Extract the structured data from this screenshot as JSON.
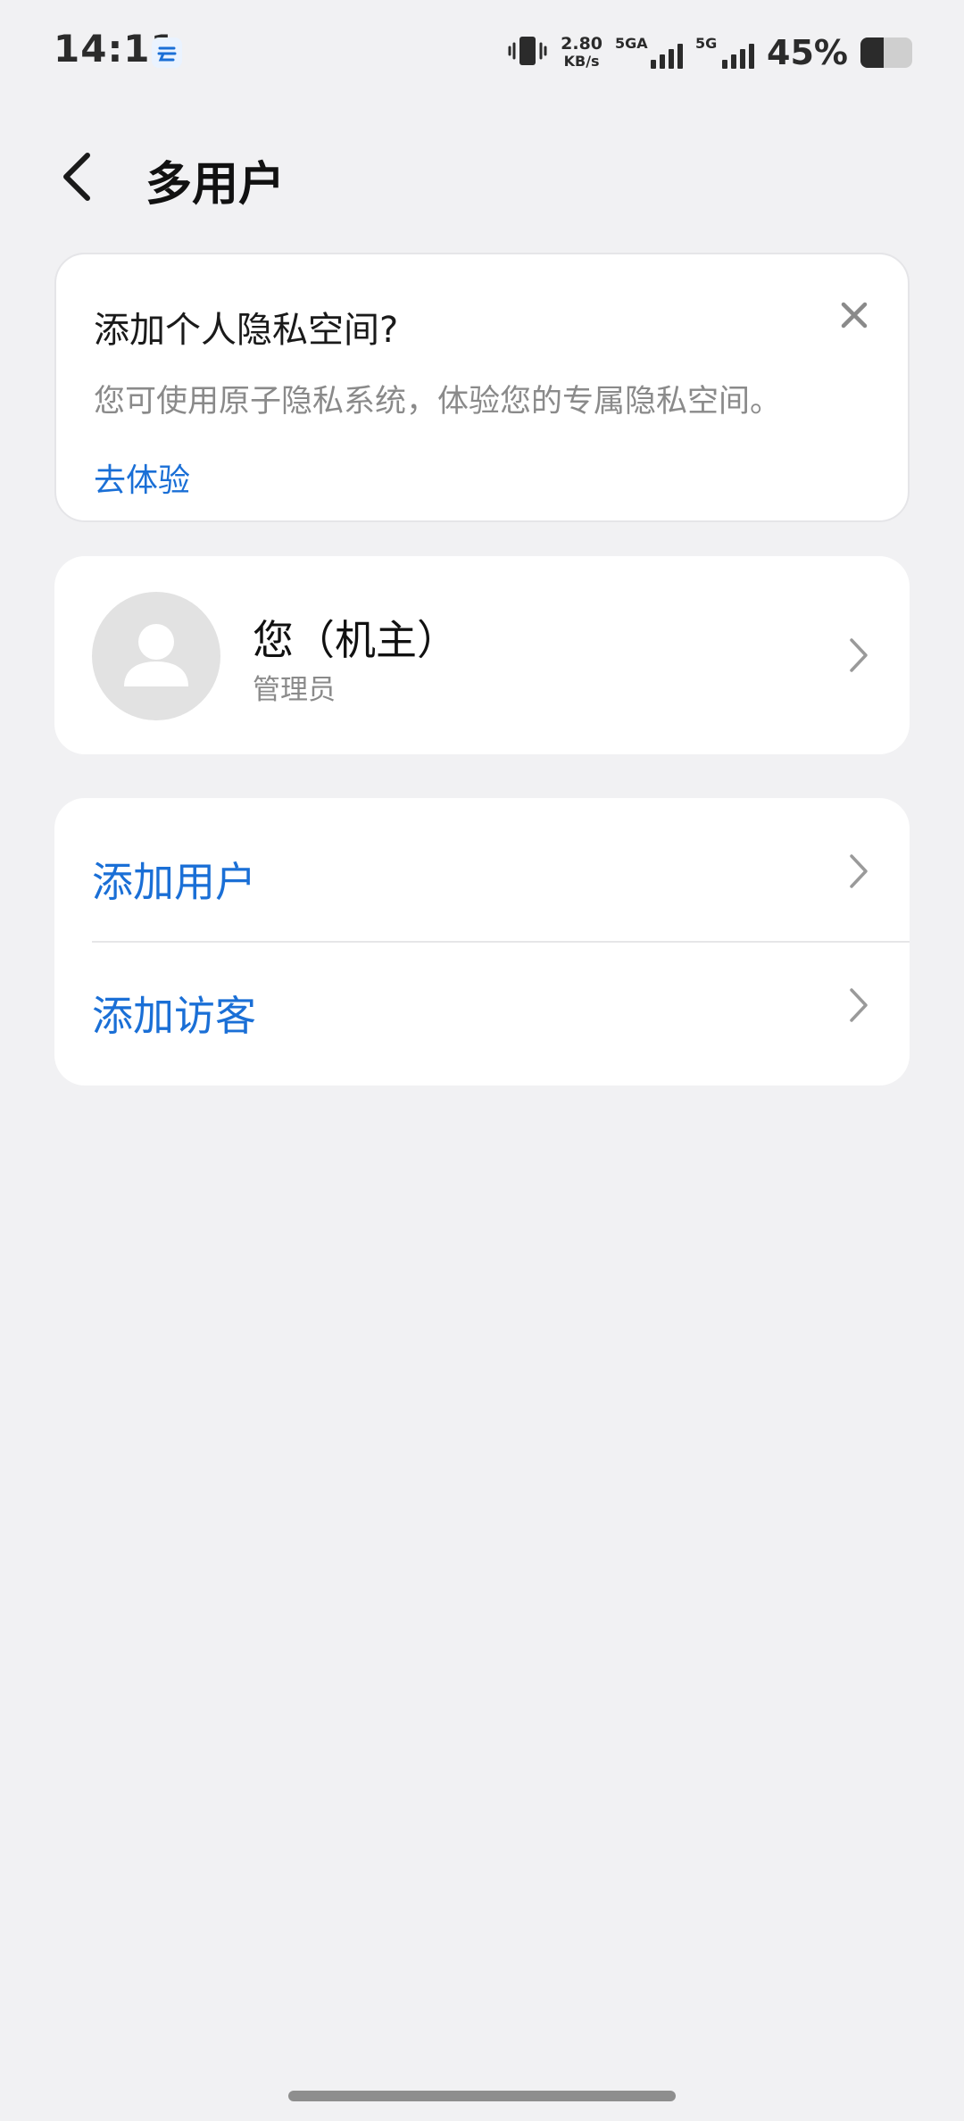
{
  "status_bar": {
    "time": "14:11",
    "app_icon": "cloud-app-icon",
    "speed_value": "2.80",
    "speed_unit": "KB/s",
    "network_1": "5GA",
    "network_2": "5G",
    "battery_percent": "45%",
    "battery_level": 0.45
  },
  "header": {
    "back_icon": "back-arrow-icon",
    "title": "多用户"
  },
  "notice": {
    "title": "添加个人隐私空间?",
    "description": "您可使用原子隐私系统，体验您的专属隐私空间。",
    "link": "去体验",
    "close_icon": "close-icon"
  },
  "owner": {
    "name": "您（机主）",
    "role": "管理员",
    "avatar_icon": "avatar-icon"
  },
  "actions": {
    "add_user": "添加用户",
    "add_guest": "添加访客"
  },
  "colors": {
    "background": "#f1f1f3",
    "accent": "#1a6fd6",
    "card": "#ffffff"
  }
}
